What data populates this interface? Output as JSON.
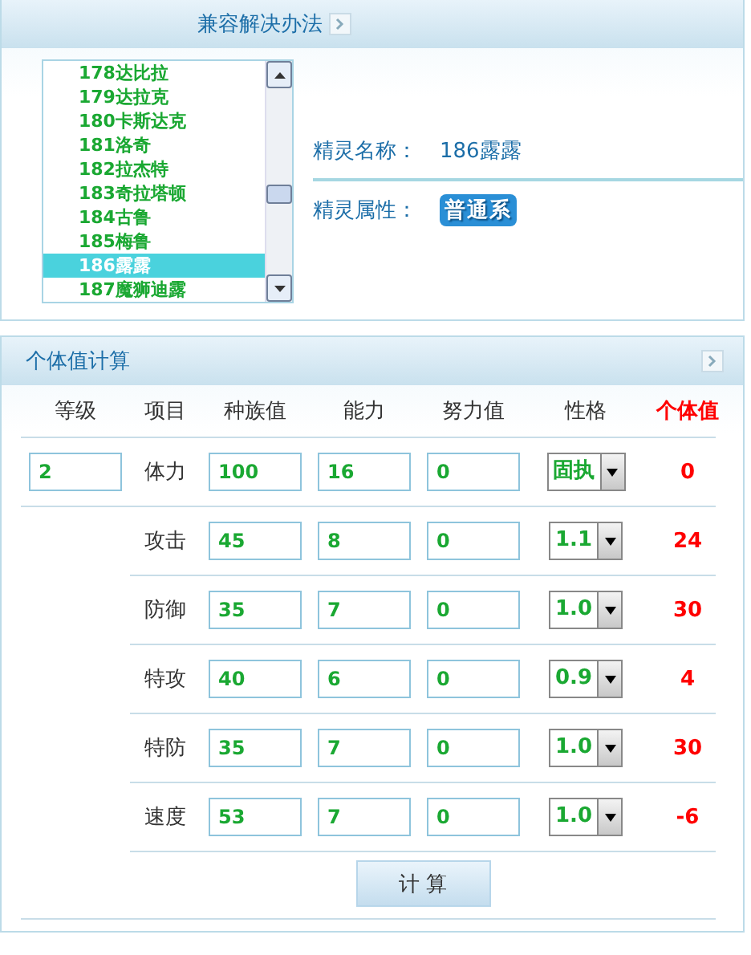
{
  "top_panel": {
    "title": "兼容解决办法"
  },
  "pet_list": [
    {
      "label": "178达比拉",
      "selected": false
    },
    {
      "label": "179达拉克",
      "selected": false
    },
    {
      "label": "180卡斯达克",
      "selected": false
    },
    {
      "label": "181洛奇",
      "selected": false
    },
    {
      "label": "182拉杰特",
      "selected": false
    },
    {
      "label": "183奇拉塔顿",
      "selected": false
    },
    {
      "label": "184古鲁",
      "selected": false
    },
    {
      "label": "185梅鲁",
      "selected": false
    },
    {
      "label": "186露露",
      "selected": true
    },
    {
      "label": "187魔狮迪露",
      "selected": false
    }
  ],
  "info": [
    {
      "label": "精灵名称：",
      "value": "186露露",
      "kind": "text"
    },
    {
      "label": "精灵属性：",
      "value": "普通系",
      "kind": "badge"
    }
  ],
  "calc_panel": {
    "title": "个体值计算",
    "columns": [
      "等级",
      "项目",
      "种族值",
      "能力",
      "努力值",
      "性格",
      "个体值"
    ],
    "level": "2",
    "rows": [
      {
        "item": "体力",
        "base": "100",
        "ability": "16",
        "effort": "0",
        "nature": "固执",
        "iv": "0"
      },
      {
        "item": "攻击",
        "base": "45",
        "ability": "8",
        "effort": "0",
        "nature": "1.1",
        "iv": "24"
      },
      {
        "item": "防御",
        "base": "35",
        "ability": "7",
        "effort": "0",
        "nature": "1.0",
        "iv": "30"
      },
      {
        "item": "特攻",
        "base": "40",
        "ability": "6",
        "effort": "0",
        "nature": "0.9",
        "iv": "4"
      },
      {
        "item": "特防",
        "base": "35",
        "ability": "7",
        "effort": "0",
        "nature": "1.0",
        "iv": "30"
      },
      {
        "item": "速度",
        "base": "53",
        "ability": "7",
        "effort": "0",
        "nature": "1.0",
        "iv": "-6"
      }
    ],
    "button": "计 算"
  }
}
